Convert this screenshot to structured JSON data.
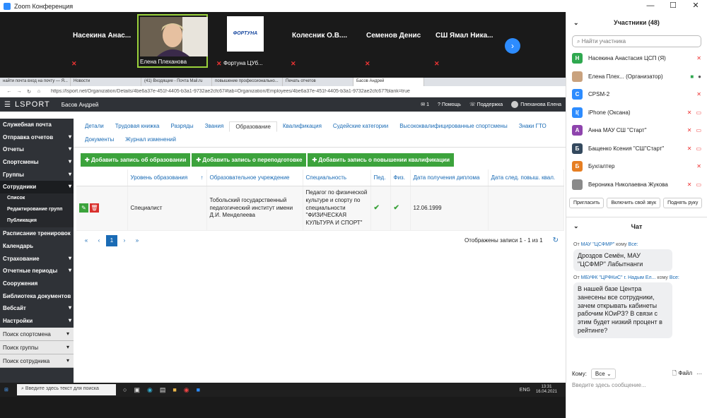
{
  "zoom": {
    "title": "Zoom Конференция",
    "controls": [
      "—",
      "☐",
      "✕"
    ]
  },
  "video_tiles": [
    {
      "name": "Насекина  Анас...",
      "sub": ""
    },
    {
      "name": "",
      "sub": "Елена Плеханова"
    },
    {
      "name": "",
      "sub": "Фортуна ЦУб..."
    },
    {
      "name": "Колесник  О.В....",
      "sub": ""
    },
    {
      "name": "Семенов Денис",
      "sub": ""
    },
    {
      "name": "СШ Ямал  Ника...",
      "sub": ""
    }
  ],
  "fortuna_logo": "ФОРТУНА",
  "browser": {
    "tabs": [
      "найти почта вход на почту — Я...",
      "Новости",
      "(41) Входящие - Почта Mail.ru",
      "повышение профессионально...",
      "Печать отчетов",
      "Басов Андрей"
    ],
    "url": "https://lsport.net/Organization/Details/4be6a37e-451f-4405-b3a1-9732ae2cfc67#tab=Organization/Employees/4be6a37e-451f-4405-b3a1-9732ae2cfc67?blank=true"
  },
  "app": {
    "logo": "LSPORT",
    "user": "Басов Андрей",
    "mail_count": "1",
    "help": "Помощь",
    "support": "Поддержка",
    "account": "Плеханова Елена"
  },
  "sidebar": {
    "items": [
      {
        "label": "Служебная почта",
        "caret": false
      },
      {
        "label": "Отправка отчетов",
        "caret": true
      },
      {
        "label": "Отчеты",
        "caret": true
      },
      {
        "label": "Спортсмены",
        "caret": true
      },
      {
        "label": "Группы",
        "caret": true
      },
      {
        "label": "Сотрудники",
        "caret": true
      }
    ],
    "subitems": [
      "Список",
      "Редактирование групп",
      "Публикация"
    ],
    "items2": [
      {
        "label": "Расписание тренировок",
        "caret": false
      },
      {
        "label": "Календарь",
        "caret": false
      },
      {
        "label": "Страхование",
        "caret": true
      },
      {
        "label": "Отчетные периоды",
        "caret": true
      },
      {
        "label": "Сооружения",
        "caret": false
      },
      {
        "label": "Библиотека документов",
        "caret": false
      },
      {
        "label": "Вебсайт",
        "caret": true
      },
      {
        "label": "Настройки",
        "caret": true
      }
    ],
    "searches": [
      "Поиск спортсмена",
      "Поиск группы",
      "Поиск сотрудника"
    ]
  },
  "subtabs": [
    "Детали",
    "Трудовая книжка",
    "Разряды",
    "Звания",
    "Образование",
    "Квалификация",
    "Судейские категории",
    "Высококвалифицированные спортсмены",
    "Знаки ГТО",
    "Документы",
    "Журнал изменений"
  ],
  "active_subtab": "Образование",
  "actions": [
    "Добавить запись об образовании",
    "Добавить запись о переподготовке",
    "Добавить запись о повышении квалификации"
  ],
  "table": {
    "headers": [
      "Уровень образования",
      "Образовательное учреждение",
      "Специальность",
      "Пед.",
      "Физ.",
      "Дата получения диплома",
      "Дата след. повыш. квал."
    ],
    "row": {
      "level": "Специалист",
      "institution": "Тобольский государственный педагогический институт имени Д.И. Менделеева",
      "specialty": "Педагог по физической культуре и спорту по специальности \"ФИЗИЧЕСКАЯ КУЛЬТУРА И СПОРТ\"",
      "ped": "✔",
      "fiz": "✔",
      "diploma_date": "12.06.1999",
      "next_date": ""
    }
  },
  "pager": {
    "first": "«",
    "prev": "‹",
    "current": "1",
    "next": "›",
    "last": "»",
    "info": "Отображены записи 1 - 1 из 1",
    "refresh": "↻"
  },
  "taskbar": {
    "search": "Введите здесь текст для поиска",
    "lang": "ENG",
    "time": "13:31",
    "date": "16.04.2021"
  },
  "participants": {
    "title": "Участники (48)",
    "search_placeholder": "Найти участника",
    "list": [
      {
        "initial": "Н",
        "color": "#2fa84f",
        "name": "Насекина Анастасия ЦСП (Я)"
      },
      {
        "initial": "",
        "color": "#c9a27e",
        "name": "Елена Плех... (Организатор)"
      },
      {
        "initial": "С",
        "color": "#2d8cff",
        "name": "CPSM-2"
      },
      {
        "initial": "I(",
        "color": "#2d8cff",
        "name": "iPhone (Оксана)"
      },
      {
        "initial": "А",
        "color": "#8e44ad",
        "name": "Анна МАУ СШ \"Старт\""
      },
      {
        "initial": "Б",
        "color": "#34495e",
        "name": "Бащенко Ксения \"СШ\"Старт\""
      },
      {
        "initial": "Б",
        "color": "#e67e22",
        "name": "Бухгалтер"
      },
      {
        "initial": "",
        "color": "#8a8a8a",
        "name": "Вероника Николаевна Жукова"
      }
    ],
    "buttons": [
      "Пригласить",
      "Включить свой звук",
      "Поднять руку"
    ]
  },
  "chat": {
    "title": "Чат",
    "messages": [
      {
        "from": "МАУ \"ЦСФМР\"",
        "to": "Все:",
        "text": "Дроздов Семён, МАУ \"ЦСФМР\" Лабытнанги"
      },
      {
        "from": "МБУФК \"ЦРФКиС\" г. Надым Ел...",
        "to": "Все:",
        "text": "В нашей базе Центра занесены все сотрудники, зачем открывать кабинеты рабочим КОиРЗ? В связи с этим будет низкий процент в рейтинге?"
      }
    ],
    "to_label": "Кому:",
    "to_value": "Все",
    "file": "Файл",
    "placeholder": "Введите здесь сообщение..."
  }
}
